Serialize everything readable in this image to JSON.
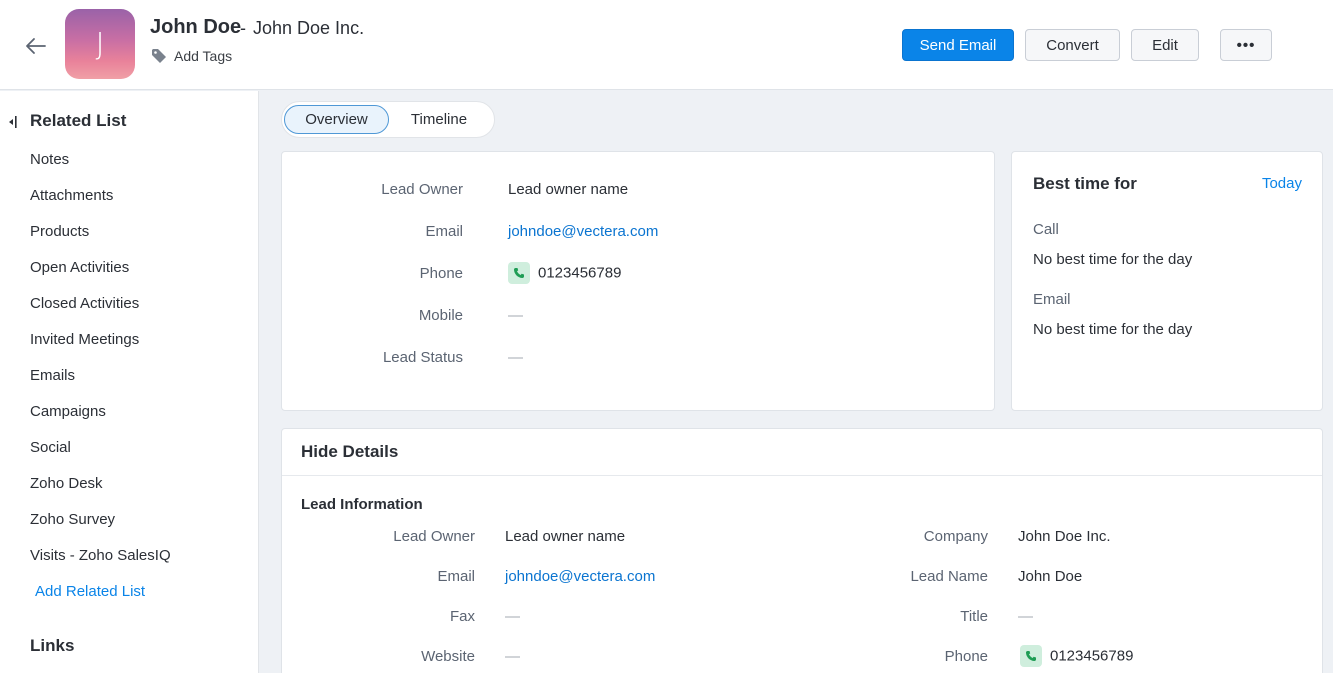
{
  "header": {
    "name": "John Doe",
    "separator": "-",
    "company": "John Doe Inc.",
    "avatar_initial": "J",
    "add_tags": "Add Tags",
    "buttons": {
      "send_email": "Send Email",
      "convert": "Convert",
      "edit": "Edit",
      "more": "•••"
    }
  },
  "sidebar": {
    "title": "Related List",
    "items": [
      "Notes",
      "Attachments",
      "Products",
      "Open Activities",
      "Closed Activities",
      "Invited Meetings",
      "Emails",
      "Campaigns",
      "Social",
      "Zoho Desk",
      "Zoho Survey",
      "Visits - Zoho SalesIQ"
    ],
    "add_related": "Add Related List",
    "links_title": "Links"
  },
  "tabs": {
    "overview": "Overview",
    "timeline": "Timeline"
  },
  "overview": {
    "lead_owner_label": "Lead Owner",
    "lead_owner": "Lead owner name",
    "email_label": "Email",
    "email": "johndoe@vectera.com",
    "phone_label": "Phone",
    "phone": "0123456789",
    "mobile_label": "Mobile",
    "mobile": "—",
    "lead_status_label": "Lead Status",
    "lead_status": "—"
  },
  "best_time": {
    "title": "Best time for",
    "today": "Today",
    "call_label": "Call",
    "call_value": "No best time for the day",
    "email_label": "Email",
    "email_value": "No best time for the day"
  },
  "details": {
    "title": "Hide Details",
    "section": "Lead Information",
    "left": {
      "lead_owner_label": "Lead Owner",
      "lead_owner": "Lead owner name",
      "email_label": "Email",
      "email": "johndoe@vectera.com",
      "fax_label": "Fax",
      "fax": "—",
      "website_label": "Website",
      "website": "—"
    },
    "right": {
      "company_label": "Company",
      "company": "John Doe Inc.",
      "lead_name_label": "Lead Name",
      "lead_name": "John Doe",
      "title_label": "Title",
      "title": "—",
      "phone_label": "Phone",
      "phone": "0123456789"
    }
  },
  "colors": {
    "primary": "#0a84e8",
    "phone_bg": "#cfeedd",
    "phone_icon": "#1f9d55"
  }
}
